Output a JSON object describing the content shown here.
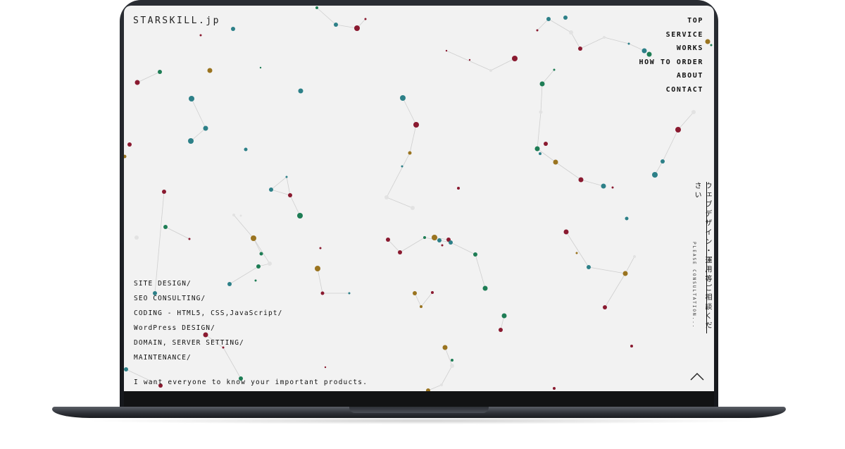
{
  "site": {
    "logo": "STARSKILL.jp",
    "nav": [
      "TOP",
      "SERVICE",
      "WORKS",
      "HOW TO ORDER",
      "ABOUT",
      "CONTACT"
    ],
    "services": [
      "SITE DESIGN/",
      "SEO CONSULTING/",
      "CODING - HTML5, CSS,JavaScript/",
      "WordPress DESIGN/",
      "DOMAIN, SERVER SETTING/",
      "MAINTENANCE/"
    ],
    "tagline": "I want everyone to know your important products.",
    "vertical_ja": "ウェブデザイン・運用等ご相談ください",
    "vertical_en": "PLEASE CONSULTATION...",
    "scroll_top_icon": "chevron-up-icon"
  },
  "colors": {
    "screen_bg": "#f2f2f2",
    "star_red": "#8a1a30",
    "star_teal": "#2d8088",
    "star_green": "#1e7d55",
    "star_gold": "#9a7420",
    "connector": "#cfcfcf"
  }
}
